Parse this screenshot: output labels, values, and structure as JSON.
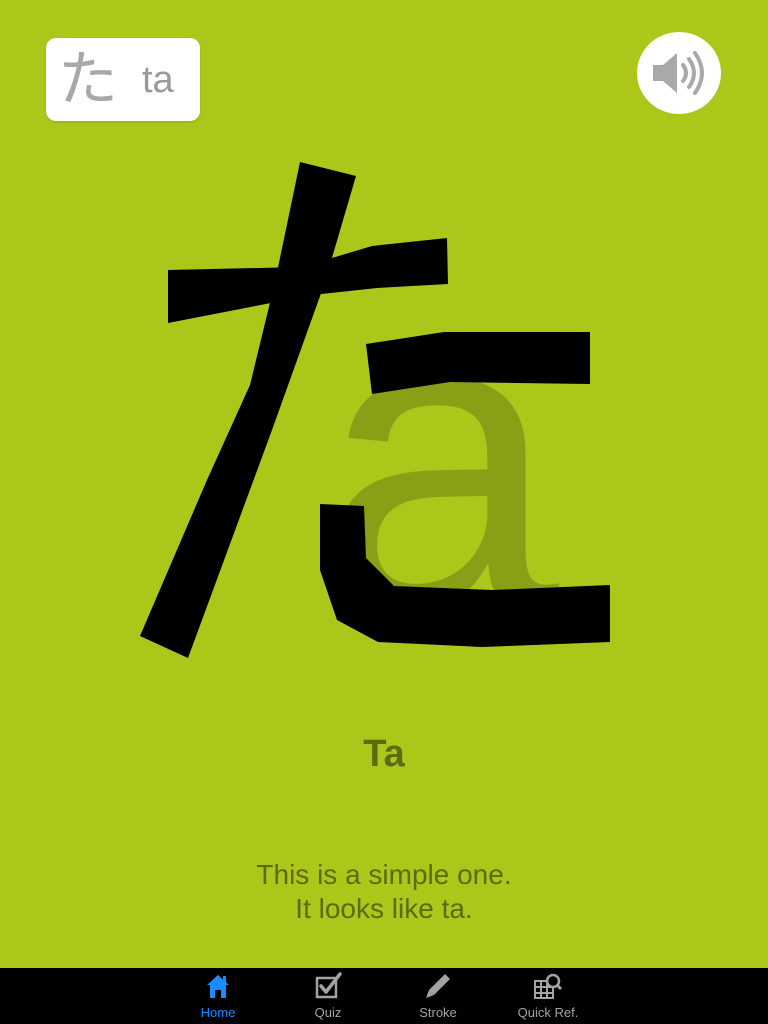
{
  "header": {
    "kana": "た",
    "romaji": "ta",
    "sound_icon": "speaker-icon"
  },
  "card": {
    "title": "Ta",
    "description": [
      "This is a simple one.",
      "It looks like ta."
    ],
    "mnemonic_letters": "a"
  },
  "colors": {
    "background": "#acc61a",
    "text": "#5d6b10",
    "stroke": "#000000",
    "tab_active": "#1a8cff",
    "tab_inactive": "#a3a3a3"
  },
  "tabbar": {
    "active": "Home",
    "items": [
      {
        "label": "Home",
        "icon": "home-icon"
      },
      {
        "label": "Quiz",
        "icon": "checkbox-icon"
      },
      {
        "label": "Stroke",
        "icon": "pencil-icon"
      },
      {
        "label": "Quick Ref.",
        "icon": "grid-search-icon"
      }
    ]
  }
}
